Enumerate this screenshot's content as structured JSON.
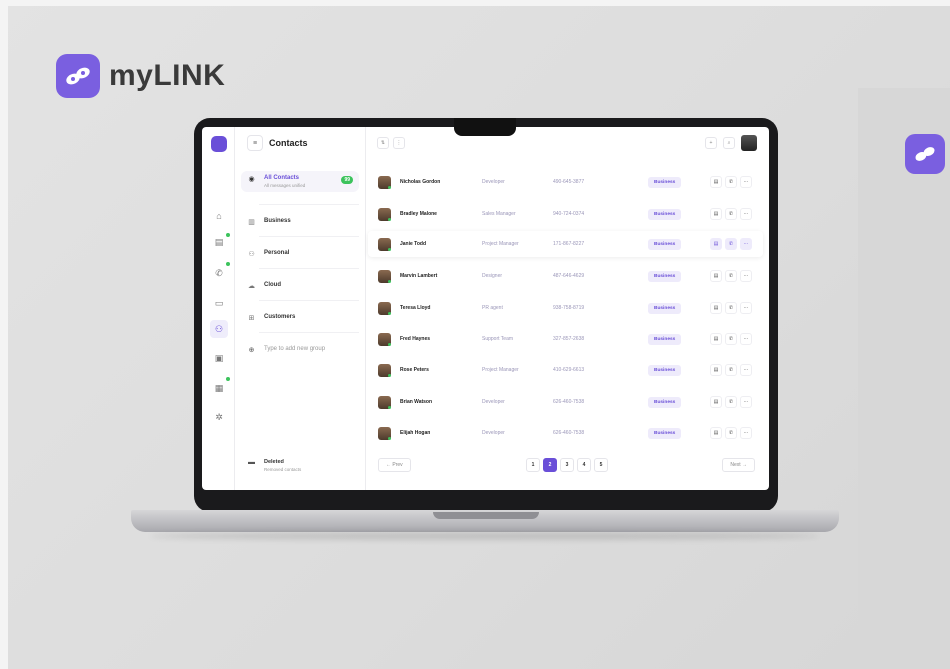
{
  "brand": {
    "name": "myLINK",
    "accent": "#7a5fe0"
  },
  "app": {
    "page_title": "Contacts",
    "rail_icons": [
      "home-icon",
      "chat-icon",
      "phone-icon",
      "devices-icon",
      "contacts-icon",
      "calendar-box-icon",
      "calendar-icon",
      "settings-icon"
    ],
    "groups": [
      {
        "label": "All Contacts",
        "sub": "All messages unified",
        "badge": "99",
        "icon": "person-circle-icon"
      },
      {
        "label": "Business",
        "icon": "building-icon"
      },
      {
        "label": "Personal",
        "icon": "people-icon"
      },
      {
        "label": "Cloud",
        "icon": "cloud-icon"
      },
      {
        "label": "Customers",
        "icon": "store-icon"
      }
    ],
    "add_group_placeholder": "Type to add new group",
    "deleted": {
      "label": "Deleted",
      "sub": "Removed contacts"
    },
    "contacts": [
      {
        "name": "Nicholas Gordon",
        "role": "Developer",
        "phone": "490-645-3877",
        "tag": "Business"
      },
      {
        "name": "Bradley Malone",
        "role": "Sales Manager",
        "phone": "940-724-0374",
        "tag": "Business"
      },
      {
        "name": "Janie Todd",
        "role": "Project Manager",
        "phone": "171-867-8227",
        "tag": "Business"
      },
      {
        "name": "Marvin Lambert",
        "role": "Designer",
        "phone": "487-646-4629",
        "tag": "Business"
      },
      {
        "name": "Teresa Lloyd",
        "role": "PR agent",
        "phone": "938-758-8719",
        "tag": "Business"
      },
      {
        "name": "Fred Haynes",
        "role": "Support Team",
        "phone": "327-857-2638",
        "tag": "Business"
      },
      {
        "name": "Rose Peters",
        "role": "Project Manager",
        "phone": "410-629-6613",
        "tag": "Business"
      },
      {
        "name": "Brian Watson",
        "role": "Developer",
        "phone": "626-460-7538",
        "tag": "Business"
      },
      {
        "name": "Elijah Hogan",
        "role": "Developer",
        "phone": "626-460-7538",
        "tag": "Business"
      }
    ],
    "pagination": {
      "prev": "← Prev",
      "next": "Next →",
      "pages": [
        "1",
        "2",
        "3",
        "4",
        "5"
      ],
      "current": "2"
    }
  }
}
